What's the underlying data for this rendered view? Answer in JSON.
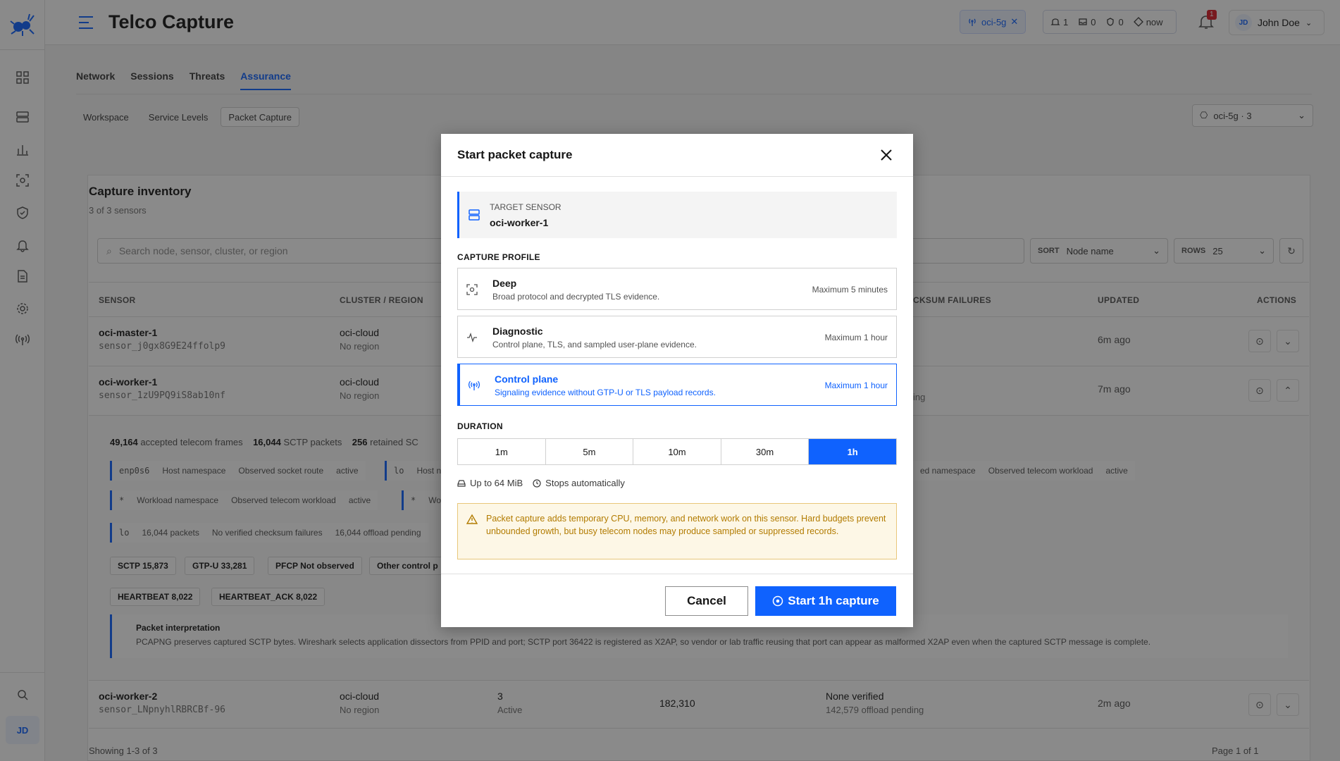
{
  "app": {
    "title": "Telco Capture"
  },
  "topbar": {
    "cluster_pill": "oci-5g",
    "stats": [
      "1",
      "0",
      "0"
    ],
    "time": "now",
    "notif_count": "1",
    "user": {
      "initials": "JD",
      "name": "John Doe"
    }
  },
  "nav": {
    "tabs": [
      "Network",
      "Sessions",
      "Threats",
      "Assurance"
    ],
    "active_tab": "Assurance",
    "subtabs": [
      "Workspace",
      "Service Levels",
      "Packet Capture"
    ],
    "active_subtab": "Packet Capture",
    "cluster_select": "oci-5g · 3"
  },
  "rail": {
    "avatar": "JD"
  },
  "inventory": {
    "title": "Capture inventory",
    "subtitle": "3 of 3 sensors",
    "search_placeholder": "Search node, sensor, cluster, or region",
    "sort_label": "SORT",
    "sort_value": "Node name",
    "rows_label": "ROWS",
    "rows_value": "25",
    "headers": {
      "sensor": "SENSOR",
      "cluster": "CLUSTER / REGION",
      "checksum": "CKSUM FAILURES",
      "updated": "UPDATED",
      "actions": "ACTIONS"
    },
    "rows": [
      {
        "name": "oci-master-1",
        "id": "sensor_j0gx8G9E24ffolp9",
        "cluster": "oci-cloud",
        "region": "No region",
        "updated": "6m ago"
      },
      {
        "name": "oci-worker-1",
        "id": "sensor_1zU9PQ9iS8ab10nf",
        "cluster": "oci-cloud",
        "region": "No region",
        "updated": "7m ago",
        "pending": "ing"
      },
      {
        "name": "oci-worker-2",
        "id": "sensor_LNpnyhlRBRCBf-96",
        "cluster": "oci-cloud",
        "region": "No region",
        "active_count": "3",
        "active_label": "Active",
        "frames": "182,310",
        "checksum": "None verified",
        "checksum_sub": "142,579 offload pending",
        "updated": "2m ago"
      }
    ],
    "expanded": {
      "summary": {
        "frames": "49,164",
        "frames_label": "accepted telecom frames",
        "sctp": "16,044",
        "sctp_label": "SCTP packets",
        "retained": "256",
        "retained_label": "retained SC"
      },
      "tag1": {
        "iface": "enp0s6",
        "ns": "Host namespace",
        "route": "Observed socket route",
        "state": "active"
      },
      "tag2": {
        "iface": "lo",
        "ns": "Host n"
      },
      "tag3": {
        "ns": "ed namespace",
        "route": "Observed telecom workload",
        "state": "active"
      },
      "tag4": {
        "iface": "*",
        "ns": "Workload namespace",
        "route": "Observed telecom workload",
        "state": "active"
      },
      "tag5": {
        "iface": "*",
        "ns": "Wo"
      },
      "tag6": {
        "iface": "lo",
        "packets": "16,044 packets",
        "checksum": "No verified checksum failures",
        "pending": "16,044 offload pending"
      },
      "chips1": [
        "SCTP 15,873",
        "GTP-U 33,281",
        "PFCP Not observed",
        "Other control p"
      ],
      "chips2": [
        "HEARTBEAT 8,022",
        "HEARTBEAT_ACK 8,022"
      ],
      "interp_title": "Packet interpretation",
      "interp_body": "PCAPNG preserves captured SCTP bytes. Wireshark selects application dissectors from PPID and port; SCTP port 36422 is registered as X2AP, so vendor or lab traffic reusing that port can appear as malformed X2AP even when the captured SCTP message is complete."
    },
    "footer": "Showing 1-3 of 3",
    "page": "Page 1 of 1"
  },
  "modal": {
    "title": "Start packet capture",
    "target_label": "TARGET SENSOR",
    "target_value": "oci-worker-1",
    "profile_label": "CAPTURE PROFILE",
    "profiles": [
      {
        "name": "Deep",
        "desc": "Broad protocol and decrypted TLS evidence.",
        "max": "Maximum 5 minutes"
      },
      {
        "name": "Diagnostic",
        "desc": "Control plane, TLS, and sampled user-plane evidence.",
        "max": "Maximum 1 hour"
      },
      {
        "name": "Control plane",
        "desc": "Signaling evidence without GTP-U or TLS payload records.",
        "max": "Maximum 1 hour"
      }
    ],
    "selected_profile": "Control plane",
    "duration_label": "DURATION",
    "durations": [
      "1m",
      "5m",
      "10m",
      "30m",
      "1h"
    ],
    "selected_duration": "1h",
    "size_limit": "Up to 64 MiB",
    "auto_stop": "Stops automatically",
    "warning": "Packet capture adds temporary CPU, memory, and network work on this sensor. Hard budgets prevent unbounded growth, but busy telecom nodes may produce sampled or suppressed records.",
    "cancel_label": "Cancel",
    "start_label": "Start 1h capture"
  },
  "colors": {
    "accent": "#0f62fe",
    "warning_bg": "#fdf7e6",
    "warning_text": "#b27b00",
    "danger": "#da1e28"
  }
}
